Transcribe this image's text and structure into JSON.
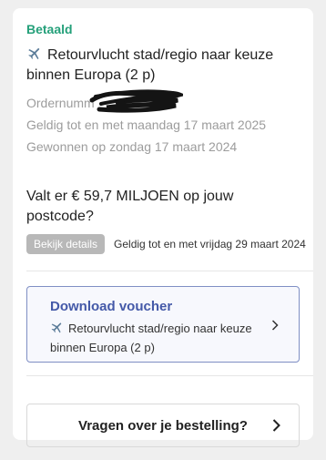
{
  "order": {
    "status": "Betaald",
    "title": "Retourvlucht stad/regio naar keuze binnen Europa (2 p)",
    "order_number_label": "Ordernumm",
    "valid_until": "Geldig tot en met maandag 17 maart 2025",
    "won_on": "Gewonnen op zondag 17 maart 2024"
  },
  "promo": {
    "title": "Valt er € 59,7 MILJOEN op jouw postcode?",
    "details_button": "Bekijk details",
    "valid_until": "Geldig tot en met vrijdag 29 maart 2024"
  },
  "voucher": {
    "title": "Download voucher",
    "description": "Retourvlucht stad/regio naar keuze binnen Europa (2 p)"
  },
  "help": {
    "label": "Vragen over je bestelling?"
  },
  "icons": {
    "plane": "airplane-icon",
    "chevron": "chevron-right-icon"
  },
  "colors": {
    "status": "#25a07a",
    "voucher_accent": "#4459a8",
    "voucher_border": "#7f8fc4"
  }
}
